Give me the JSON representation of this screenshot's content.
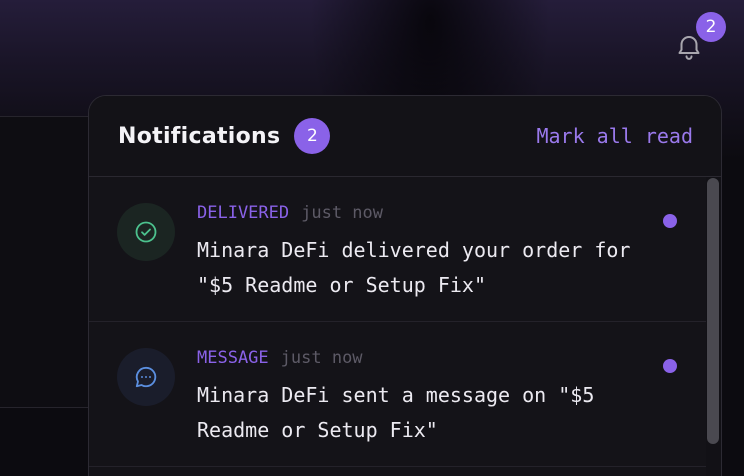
{
  "bell": {
    "icon": "bell-icon",
    "badge": "2"
  },
  "panel": {
    "title": "Notifications",
    "count": "2",
    "mark_all_label": "Mark all read",
    "items": [
      {
        "icon": "check-circle-icon",
        "tag": "DELIVERED",
        "time": "just now",
        "text": "Minara DeFi delivered your order for \"$5 Readme or Setup Fix\"",
        "unread": true
      },
      {
        "icon": "chat-bubble-icon",
        "tag": "MESSAGE",
        "time": "just now",
        "text": "Minara DeFi sent a message on \"$5 Readme or Setup Fix\"",
        "unread": true
      }
    ]
  },
  "colors": {
    "accent": "#8a62e8",
    "link": "#9a79ec",
    "panel_bg": "#141318",
    "delivered_icon": "#4cc28e",
    "message_icon": "#5b8fe0"
  }
}
